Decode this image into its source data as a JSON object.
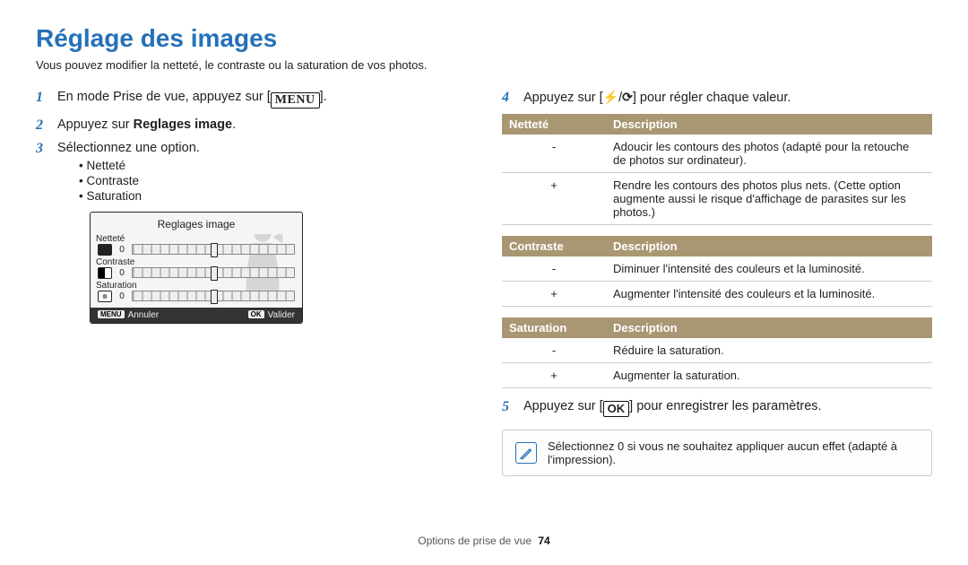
{
  "title": "Réglage des images",
  "intro": "Vous pouvez modifier la netteté, le contraste ou la saturation de vos photos.",
  "left": {
    "step1_pre": "En mode Prise de vue, appuyez sur [",
    "step1_btn": "MENU",
    "step1_post": "].",
    "step2_pre": "Appuyez sur ",
    "step2_bold": "Reglages image",
    "step2_post": ".",
    "step3": "Sélectionnez une option.",
    "bullets": [
      "Netteté",
      "Contraste",
      "Saturation"
    ]
  },
  "lcd": {
    "header": "Reglages image",
    "rows": [
      {
        "label": "Netteté",
        "value": "0"
      },
      {
        "label": "Contraste",
        "value": "0"
      },
      {
        "label": "Saturation",
        "value": "0"
      }
    ],
    "footer_left_tag": "MENU",
    "footer_left": "Annuler",
    "footer_right_tag": "OK",
    "footer_right": "Valider"
  },
  "right": {
    "step4_pre": "Appuyez sur [",
    "step4_icon1": "⚡",
    "step4_sep": "/",
    "step4_icon2": "⟳",
    "step4_post": "] pour régler chaque valeur.",
    "step5_pre": "Appuyez sur [",
    "step5_btn": "OK",
    "step5_post": "] pour enregistrer les paramètres."
  },
  "tables": {
    "nettete": {
      "h1": "Netteté",
      "h2": "Description",
      "rows": [
        {
          "k": "-",
          "v": "Adoucir les contours des photos (adapté pour la retouche de photos sur ordinateur)."
        },
        {
          "k": "+",
          "v": "Rendre les contours des photos plus nets. (Cette option augmente aussi le risque d'affichage de parasites sur les photos.)"
        }
      ]
    },
    "contraste": {
      "h1": "Contraste",
      "h2": "Description",
      "rows": [
        {
          "k": "-",
          "v": "Diminuer l'intensité des couleurs et la luminosité."
        },
        {
          "k": "+",
          "v": "Augmenter l'intensité des couleurs et la luminosité."
        }
      ]
    },
    "saturation": {
      "h1": "Saturation",
      "h2": "Description",
      "rows": [
        {
          "k": "-",
          "v": "Réduire la saturation."
        },
        {
          "k": "+",
          "v": "Augmenter la saturation."
        }
      ]
    }
  },
  "note": "Sélectionnez 0 si vous ne souhaitez appliquer aucun effet (adapté à l'impression).",
  "footer": {
    "section": "Options de prise de vue",
    "page": "74"
  }
}
